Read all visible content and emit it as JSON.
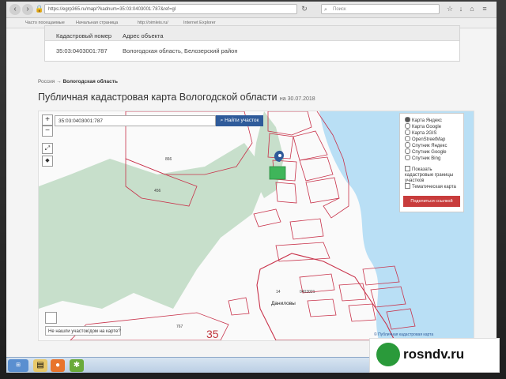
{
  "browser": {
    "url": "https://egrp365.ru/map/?kadnum=35:03:0403001:787&ref=gl",
    "search_placeholder": "Поиск",
    "bookmarks": [
      "Часто посещаемые",
      "Начальная страница",
      "http://oimleis.ru/",
      "Internet Explorer"
    ]
  },
  "info_table": {
    "col_number": "Кадастровый номер",
    "col_address": "Адрес объекта",
    "number": "35:03:0403001:787",
    "address": "Вологодская область, Белозерский район"
  },
  "breadcrumb": {
    "root": "Россия",
    "arrow": "→",
    "current": "Вологодская область"
  },
  "title": {
    "main": "Публичная кадастровая карта Вологодской области",
    "date": "на 30.07.2018"
  },
  "map": {
    "search_value": "35:03:0403001:787",
    "find_button": "Найти участок",
    "zoom_in": "+",
    "zoom_out": "−",
    "layers": [
      {
        "label": "Карта Яндекс",
        "checked": true
      },
      {
        "label": "Карта Google",
        "checked": false
      },
      {
        "label": "Карта 2GIS",
        "checked": false
      },
      {
        "label": "OpenStreetMap",
        "checked": false
      },
      {
        "label": "Спутник Яндекс",
        "checked": false
      },
      {
        "label": "Спутник Google",
        "checked": false
      },
      {
        "label": "Спутник Bing",
        "checked": false
      }
    ],
    "option_borders": "Показать кадастровые границы участков",
    "option_thematic": "Тематическая карта",
    "share_button": "Поделиться ссылкой",
    "not_found": "Не нашли участок/дом на карте?",
    "labels": {
      "parcel_866": "866",
      "parcel_456": "456",
      "parcel_767": "767",
      "block": "0403021",
      "block_num": "14",
      "village": "Даниловы",
      "district": "35"
    },
    "attribution": "© Публичная кадастровая карта",
    "colors": {
      "water": "#b9dff5",
      "forest": "#c7dfcb",
      "parcel": "#c8324a",
      "selected": "#3fb55a"
    }
  },
  "taskbar": {
    "items": [
      "start",
      "explorer",
      "firefox",
      "settings"
    ]
  },
  "watermark": "rosndv.ru"
}
